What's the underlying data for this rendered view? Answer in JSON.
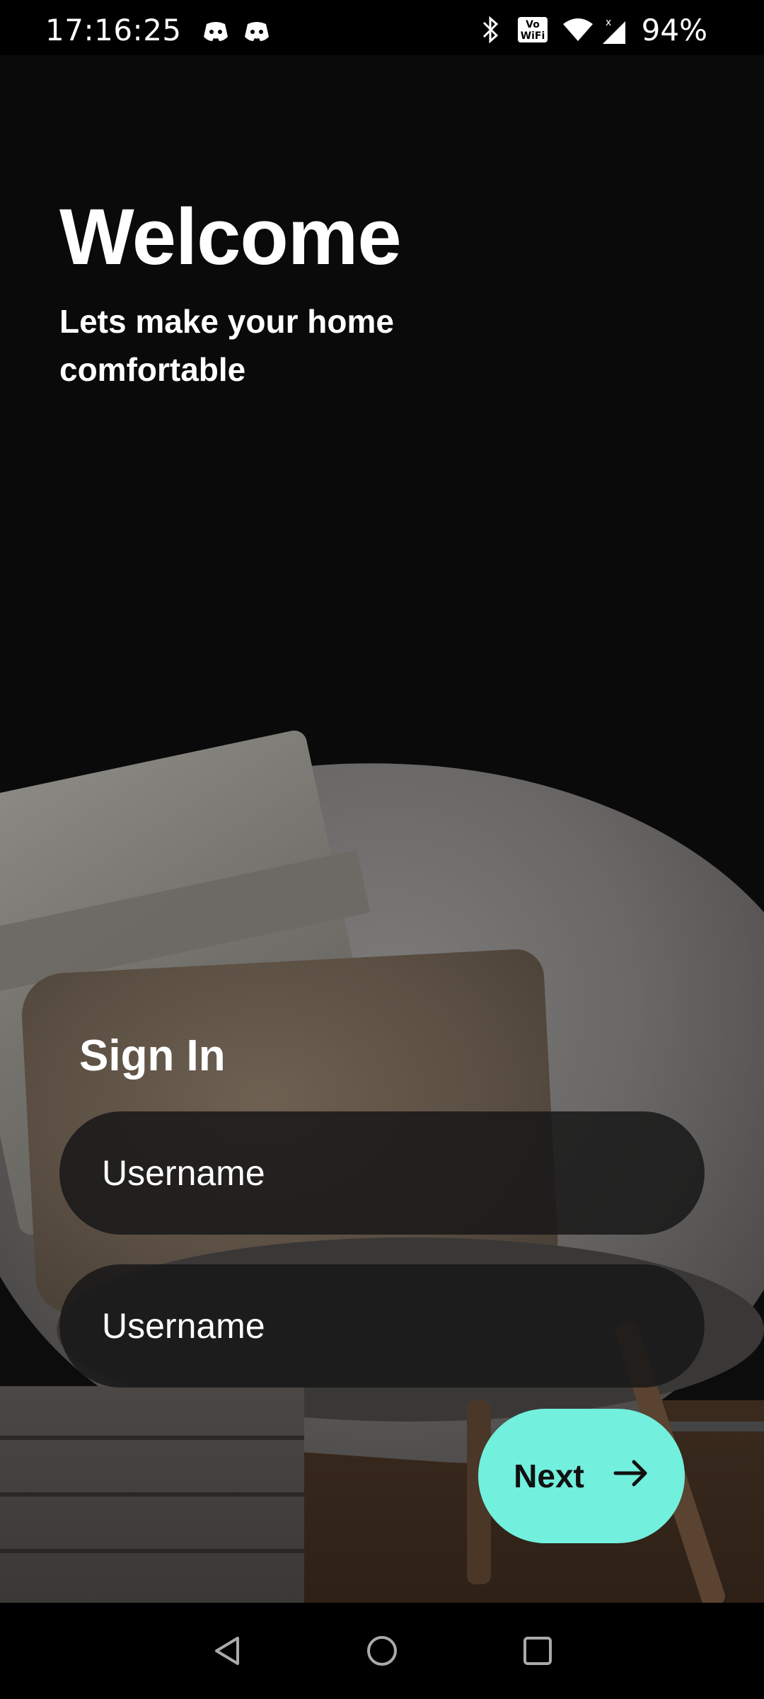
{
  "status_bar": {
    "time": "17:16:25",
    "battery": "94%",
    "icons": [
      "discord-icon",
      "discord-icon",
      "bluetooth-icon",
      "vowifi-icon",
      "wifi-icon",
      "signal-icon"
    ]
  },
  "header": {
    "title": "Welcome",
    "subtitle": "Lets make your home comfortable"
  },
  "form": {
    "heading": "Sign In",
    "username_placeholder": "Username",
    "password_placeholder": "Username",
    "next_label": "Next"
  },
  "colors": {
    "accent": "#72EFDD",
    "background": "#0A0A0A",
    "field_bg": "#181818"
  }
}
